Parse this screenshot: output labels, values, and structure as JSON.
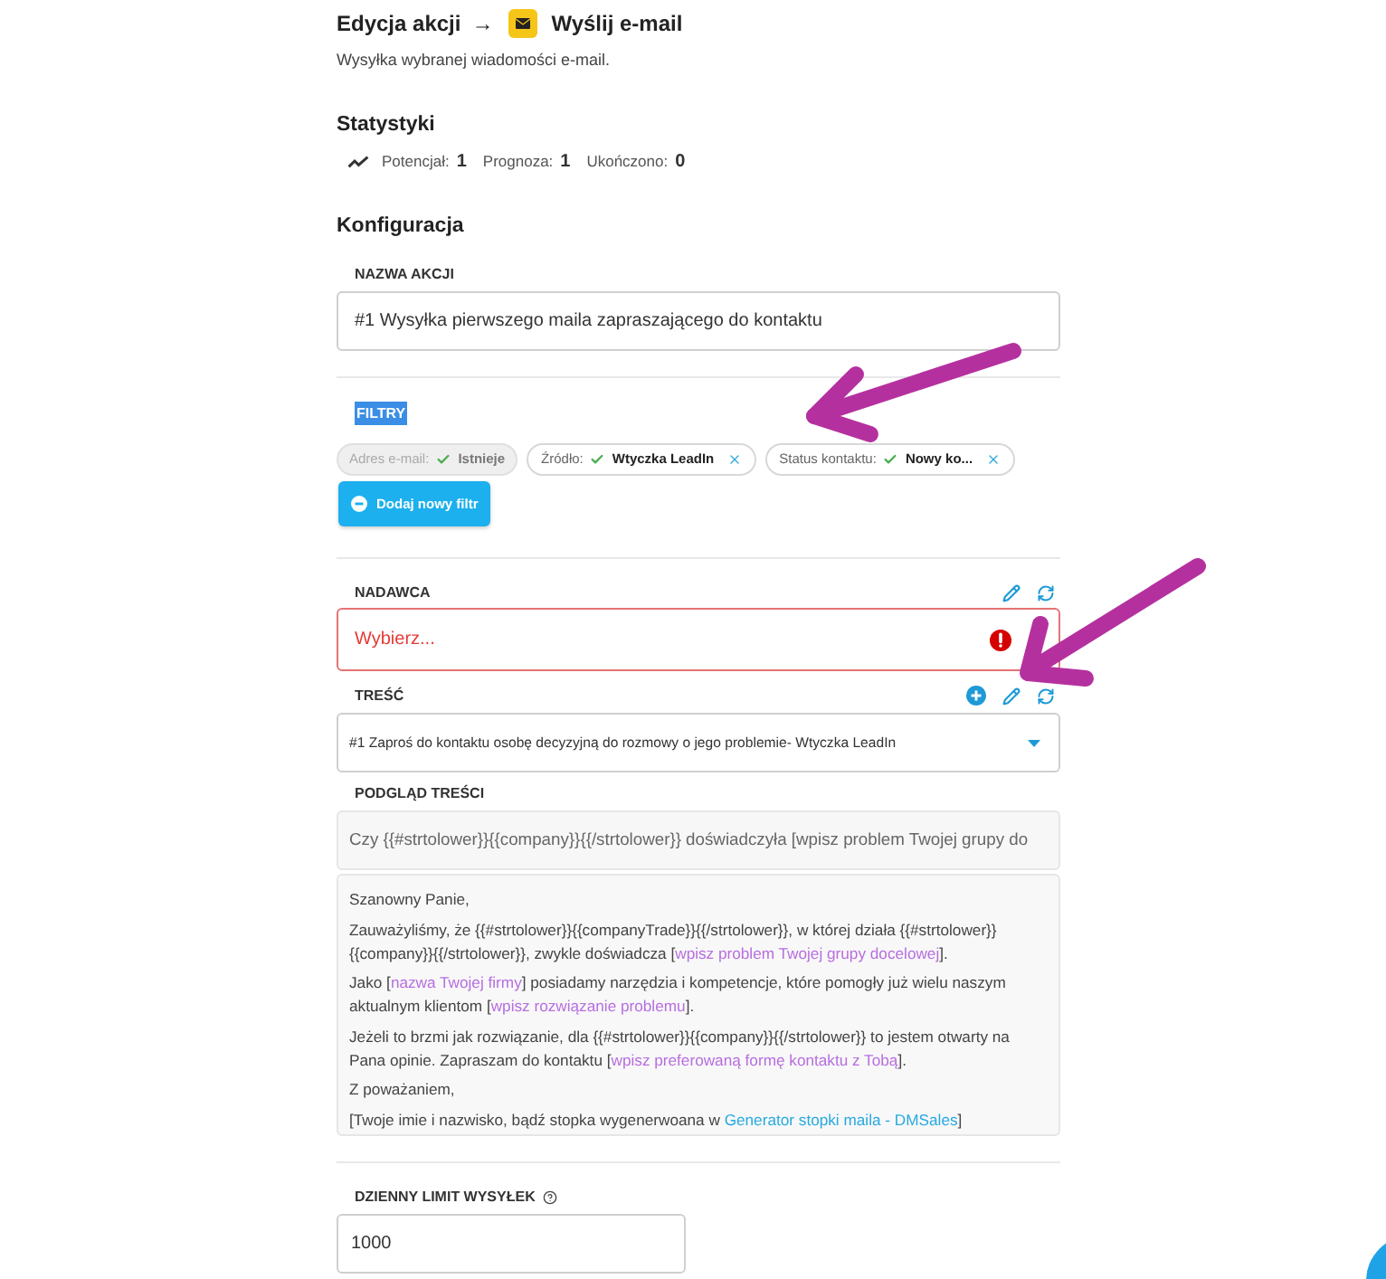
{
  "header": {
    "breadcrumb": "Edycja akcji",
    "separator": "→",
    "action_title": "Wyślij e-mail",
    "description": "Wysyłka wybranej wiadomości e-mail."
  },
  "statistics": {
    "title": "Statystyki",
    "items": [
      {
        "label": "Potencjał:",
        "value": "1"
      },
      {
        "label": "Prognoza:",
        "value": "1"
      },
      {
        "label": "Ukończono:",
        "value": "0"
      }
    ]
  },
  "configuration": {
    "title": "Konfiguracja",
    "action_name": {
      "label": "NAZWA AKCJI",
      "value": "#1 Wysyłka pierwszego maila zapraszającego do kontaktu"
    },
    "filters": {
      "label": "FILTRY",
      "highlighted": true,
      "items": [
        {
          "label": "Adres e-mail:",
          "value": "Istnieje",
          "disabled": true
        },
        {
          "label": "Źródło:",
          "value": "Wtyczka LeadIn",
          "disabled": false
        },
        {
          "label": "Status kontaktu:",
          "value": "Nowy ko...",
          "disabled": false
        }
      ],
      "add_button": "Dodaj nowy filtr"
    },
    "sender": {
      "label": "NADAWCA",
      "placeholder": "Wybierz...",
      "error": true
    },
    "content": {
      "label": "TREŚĆ",
      "value": "#1 Zaproś do kontaktu osobę decyzyjną do rozmowy o jego problemie- Wtyczka LeadIn"
    },
    "preview": {
      "label": "PODGLĄD TREŚCI",
      "subject": "Czy {{#strtolower}}{{company}}{{/strtolower}} doświadczyła [wpisz problem Twojej grupy do",
      "paragraphs": [
        [
          {
            "kind": "text",
            "text": "Szanowny Panie,"
          }
        ],
        [
          {
            "kind": "text",
            "text": "Zauważyliśmy, że {{#strtolower}}{{companyTrade}}{{/strtolower}}, w której działa {{#strtolower}}{{company}}{{/strtolower}}, zwykle doświadcza ["
          },
          {
            "kind": "placeholder",
            "text": "wpisz problem Twojej grupy docelowej"
          },
          {
            "kind": "text",
            "text": "]."
          }
        ],
        [
          {
            "kind": "text",
            "text": "Jako ["
          },
          {
            "kind": "placeholder",
            "text": "nazwa Twojej firmy"
          },
          {
            "kind": "text",
            "text": "] posiadamy narzędzia i kompetencje, które pomogły już wielu naszym aktualnym klientom ["
          },
          {
            "kind": "placeholder",
            "text": "wpisz rozwiązanie problemu"
          },
          {
            "kind": "text",
            "text": "]."
          }
        ],
        [
          {
            "kind": "text",
            "text": "Jeżeli to brzmi jak rozwiązanie, dla {{#strtolower}}{{company}}{{/strtolower}} to jestem otwarty na Pana opinie. Zapraszam do kontaktu ["
          },
          {
            "kind": "placeholder",
            "text": "wpisz preferowaną formę kontaktu z Tobą"
          },
          {
            "kind": "text",
            "text": "]."
          }
        ],
        [
          {
            "kind": "text",
            "text": "Z poważaniem,"
          }
        ],
        [
          {
            "kind": "text",
            "text": "[Twoje imie i nazwisko, bądź stopka wygenerwoana w "
          },
          {
            "kind": "link",
            "text": "Generator stopki maila - DMSales"
          },
          {
            "kind": "text",
            "text": "]"
          }
        ]
      ]
    },
    "daily_limit": {
      "label": "DZIENNY LIMIT WYSYŁEK",
      "value": "1000"
    }
  }
}
